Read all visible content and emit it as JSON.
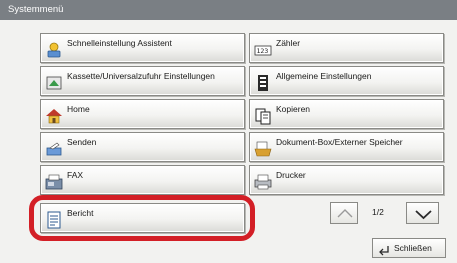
{
  "window": {
    "title": "Systemmenü"
  },
  "menu": {
    "items": [
      {
        "label": "Schnelleinstellung Assistent",
        "icon": "quick-setup-wizard-icon"
      },
      {
        "label": "Zähler",
        "icon": "counter-icon"
      },
      {
        "label": "Kassette/Universalzufuhr Einstellungen",
        "icon": "cassette-tray-icon"
      },
      {
        "label": "Allgemeine Einstellungen",
        "icon": "common-settings-icon"
      },
      {
        "label": "Home",
        "icon": "home-icon"
      },
      {
        "label": "Kopieren",
        "icon": "copy-icon"
      },
      {
        "label": "Senden",
        "icon": "send-icon"
      },
      {
        "label": "Dokument-Box/Externer Speicher",
        "icon": "document-box-icon"
      },
      {
        "label": "FAX",
        "icon": "fax-icon"
      },
      {
        "label": "Drucker",
        "icon": "printer-icon"
      },
      {
        "label": "Bericht",
        "icon": "report-icon"
      }
    ]
  },
  "pagination": {
    "current_label": "1/2",
    "up_icon": "chevron-up-icon",
    "down_icon": "chevron-down-icon"
  },
  "footer": {
    "close_label": "Schließen",
    "close_icon": "return-arrow-icon"
  },
  "colors": {
    "titlebar": "#7a7f84",
    "highlight": "#d31f26",
    "panel": "#f2f2f0"
  }
}
